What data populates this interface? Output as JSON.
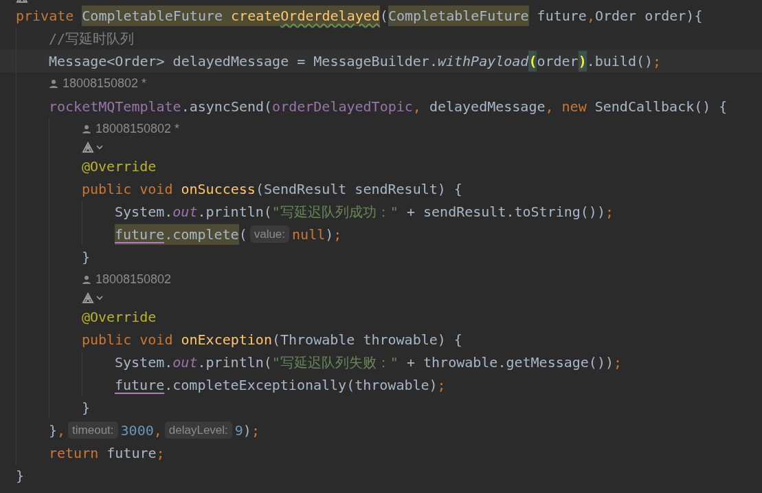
{
  "editor": {
    "lines": [
      {
        "kind": "icons",
        "clipped": true
      },
      {
        "kind": "code",
        "tokens": [
          {
            "kind": "keyword",
            "text": "private "
          },
          {
            "kind": "type",
            "text": "CompletableFuture",
            "highlighted": true
          },
          {
            "kind": "method",
            "text": " create",
            "highlighted": true
          },
          {
            "kind": "method",
            "text": "Orderdelayed",
            "highlighted": true,
            "misspelled": true
          },
          {
            "kind": "plain",
            "text": "("
          },
          {
            "kind": "type",
            "text": "CompletableFuture",
            "highlighted": true
          },
          {
            "kind": "plain",
            "text": " future"
          },
          {
            "kind": "punct",
            "text": ","
          },
          {
            "kind": "plain",
            "text": "Order order){"
          }
        ],
        "children": [
          {
            "kind": "code",
            "tokens": [
              {
                "kind": "comment",
                "text": "//写延时队列"
              }
            ]
          },
          {
            "kind": "code",
            "current": true,
            "tokens": [
              {
                "kind": "plain",
                "text": "Message<Order> delayedMessage = MessageBuilder."
              },
              {
                "kind": "static-method",
                "text": "withPayload"
              },
              {
                "kind": "plain",
                "text": "(",
                "matched": true
              },
              {
                "kind": "plain",
                "text": "order"
              },
              {
                "kind": "plain",
                "text": ")",
                "matched": true
              },
              {
                "kind": "plain",
                "text": ".build()"
              },
              {
                "kind": "punct",
                "text": ";"
              }
            ]
          },
          {
            "kind": "author",
            "text": "18008150802 *"
          },
          {
            "kind": "code",
            "tokens": [
              {
                "kind": "field",
                "text": "rocketMQTemplate"
              },
              {
                "kind": "plain",
                "text": ".asyncSend("
              },
              {
                "kind": "field",
                "text": "orderDelayedTopic"
              },
              {
                "kind": "punct",
                "text": ", "
              },
              {
                "kind": "plain",
                "text": "delayedMessage"
              },
              {
                "kind": "punct",
                "text": ", "
              },
              {
                "kind": "keyword",
                "text": "new"
              },
              {
                "kind": "plain",
                "text": " SendCallback() {"
              }
            ],
            "children": [
              {
                "kind": "author",
                "text": "18008150802 *"
              },
              {
                "kind": "icons",
                "clipped": false
              },
              {
                "kind": "code",
                "tokens": [
                  {
                    "kind": "annotation",
                    "text": "@Override"
                  }
                ]
              },
              {
                "kind": "code",
                "tokens": [
                  {
                    "kind": "keyword",
                    "text": "public void "
                  },
                  {
                    "kind": "method",
                    "text": "onSuccess"
                  },
                  {
                    "kind": "plain",
                    "text": "(SendResult sendResult) {"
                  }
                ],
                "children": [
                  {
                    "kind": "code",
                    "tokens": [
                      {
                        "kind": "plain",
                        "text": "System."
                      },
                      {
                        "kind": "static-field",
                        "text": "out"
                      },
                      {
                        "kind": "plain",
                        "text": ".println("
                      },
                      {
                        "kind": "string",
                        "text": "\"写延迟队列成功：\""
                      },
                      {
                        "kind": "plain",
                        "text": " + sendResult.toString())"
                      },
                      {
                        "kind": "punct",
                        "text": ";"
                      }
                    ]
                  },
                  {
                    "kind": "code",
                    "tokens": [
                      {
                        "kind": "plain",
                        "text": "future",
                        "highlighted": true,
                        "underlined": true
                      },
                      {
                        "kind": "plain",
                        "text": ".complete",
                        "highlighted": true
                      },
                      {
                        "kind": "plain",
                        "text": "("
                      },
                      {
                        "kind": "hint",
                        "text": "value:"
                      },
                      {
                        "kind": "keyword",
                        "text": "null"
                      },
                      {
                        "kind": "plain",
                        "text": ")"
                      },
                      {
                        "kind": "punct",
                        "text": ";"
                      }
                    ]
                  }
                ]
              },
              {
                "kind": "code",
                "tokens": [
                  {
                    "kind": "plain",
                    "text": "}"
                  }
                ]
              },
              {
                "kind": "author",
                "text": "18008150802"
              },
              {
                "kind": "icons",
                "clipped": false
              },
              {
                "kind": "code",
                "tokens": [
                  {
                    "kind": "annotation",
                    "text": "@Override"
                  }
                ]
              },
              {
                "kind": "code",
                "tokens": [
                  {
                    "kind": "keyword",
                    "text": "public void "
                  },
                  {
                    "kind": "method",
                    "text": "onException"
                  },
                  {
                    "kind": "plain",
                    "text": "(Throwable throwable) {"
                  }
                ],
                "children": [
                  {
                    "kind": "code",
                    "tokens": [
                      {
                        "kind": "plain",
                        "text": "System."
                      },
                      {
                        "kind": "static-field",
                        "text": "out"
                      },
                      {
                        "kind": "plain",
                        "text": ".println("
                      },
                      {
                        "kind": "string",
                        "text": "\"写延迟队列失败：\""
                      },
                      {
                        "kind": "plain",
                        "text": " + throwable.getMessage())"
                      },
                      {
                        "kind": "punct",
                        "text": ";"
                      }
                    ]
                  },
                  {
                    "kind": "code",
                    "tokens": [
                      {
                        "kind": "plain",
                        "text": "future",
                        "underlined": true
                      },
                      {
                        "kind": "plain",
                        "text": ".completeExceptionally(throwable)"
                      },
                      {
                        "kind": "punct",
                        "text": ";"
                      }
                    ]
                  }
                ]
              },
              {
                "kind": "code",
                "tokens": [
                  {
                    "kind": "plain",
                    "text": "}"
                  }
                ]
              }
            ]
          },
          {
            "kind": "code",
            "tokens": [
              {
                "kind": "plain",
                "text": "}"
              },
              {
                "kind": "punct",
                "text": ","
              },
              {
                "kind": "hint",
                "text": "timeout:"
              },
              {
                "kind": "number",
                "text": "3000"
              },
              {
                "kind": "punct",
                "text": ","
              },
              {
                "kind": "hint",
                "text": "delayLevel:"
              },
              {
                "kind": "number",
                "text": "9"
              },
              {
                "kind": "plain",
                "text": ")"
              },
              {
                "kind": "punct",
                "text": ";"
              }
            ]
          },
          {
            "kind": "code",
            "tokens": [
              {
                "kind": "keyword",
                "text": "return"
              },
              {
                "kind": "plain",
                "text": " future"
              },
              {
                "kind": "punct",
                "text": ";"
              }
            ]
          }
        ]
      },
      {
        "kind": "code",
        "tokens": [
          {
            "kind": "plain",
            "text": "}"
          }
        ]
      }
    ]
  }
}
